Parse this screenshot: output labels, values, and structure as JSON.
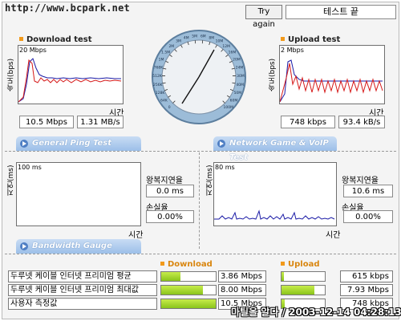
{
  "header": {
    "url": "http://www.bcpark.net",
    "try_again": "Try again",
    "status": "테스트 끝"
  },
  "download": {
    "title": "Download test",
    "scale": "20 Mbps",
    "ylabel": "속도(bps)",
    "xlabel": "시간",
    "bps": "10.5 Mbps",
    "bytes": "1.31 MB/s"
  },
  "upload": {
    "title": "Upload test",
    "scale": "2 Mbps",
    "ylabel": "속도(bps)",
    "xlabel": "시간",
    "bps": "748 kbps",
    "bytes": "93.4 kB/s"
  },
  "gauge": {
    "ticks": [
      "0",
      "64K",
      "128K",
      "256K",
      "512K",
      "768K",
      "1M",
      "1.5M",
      "2M",
      "3M",
      "4M",
      "5M",
      "6M",
      "8M",
      "10M",
      "12M",
      "16M",
      "20M",
      "24M",
      "30M",
      "40M",
      "50M",
      "60M",
      "100M"
    ],
    "needle_value": "10.5M"
  },
  "ping": {
    "tab": "General Ping Test",
    "scale": "100 ms",
    "ylabel": "지연(ms)",
    "xlabel": "시간",
    "rtt_label": "왕복지연율",
    "rtt_value": "0.0 ms",
    "loss_label": "손실율",
    "loss_value": "0.00%"
  },
  "game": {
    "tab": "Network Game & VoIP Test",
    "scale": "80 ms",
    "ylabel": "지연(ms)",
    "xlabel": "시간",
    "rtt_label": "왕복지연율",
    "rtt_value": "10.6 ms",
    "loss_label": "손실율",
    "loss_value": "0.00%"
  },
  "bandwidth": {
    "tab": "Bandwidth Gauge",
    "download_header": "Download",
    "upload_header": "Upload",
    "rows": [
      {
        "label": "두루넷 케이블 인터넷 프리미엄 평균",
        "down": "3.86 Mbps",
        "down_fill": 0.36,
        "up": "615 kbps",
        "up_fill": 0.06
      },
      {
        "label": "두루넷 케이블 인터넷 프리미엄 최대값",
        "down": "8.00 Mbps",
        "down_fill": 0.76,
        "up": "7.93 Mbps",
        "up_fill": 0.76
      },
      {
        "label": "사용자 측정값",
        "down": "10.5 Mbps",
        "down_fill": 1.0,
        "up": "748 kbps",
        "up_fill": 0.07
      }
    ]
  },
  "watermark": "마틸올 알다 / 2003-12-14 04:28:13",
  "colors": {
    "accent_orange": "#f29a1b",
    "tab_blue": "#9cbfe8",
    "series_blue": "#1a1aa6",
    "series_red": "#d61a1a",
    "bar_green": "#9acd1f"
  }
}
